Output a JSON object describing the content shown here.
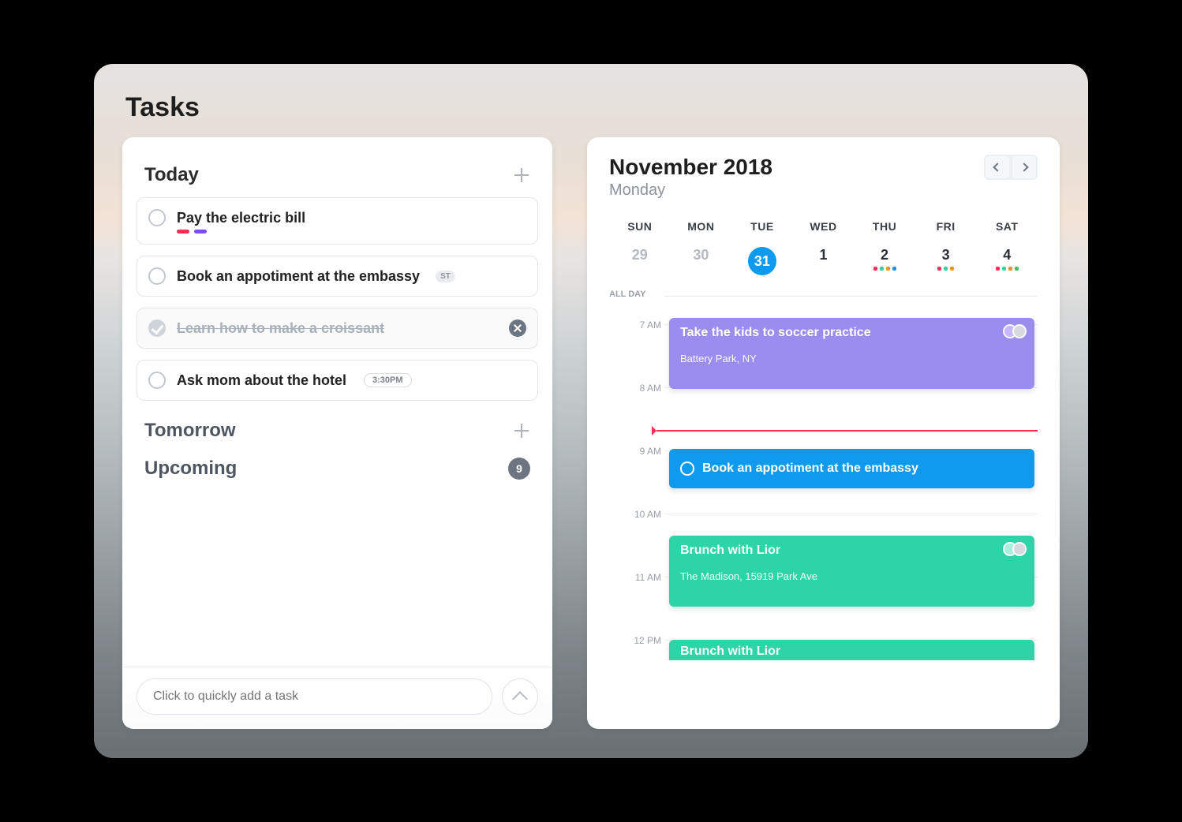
{
  "page": {
    "title": "Tasks"
  },
  "colors": {
    "pink": "#ff2d55",
    "purple": "#7c4dff",
    "blue": "#0f9af0",
    "teal": "#2dd4a7",
    "lilac": "#9b8cf0",
    "orange": "#ff9500",
    "green": "#34c759"
  },
  "tasks": {
    "sections": {
      "today": {
        "title": "Today"
      },
      "tomorrow": {
        "title": "Tomorrow"
      },
      "upcoming": {
        "title": "Upcoming",
        "count": "9"
      }
    },
    "today_items": [
      {
        "title": "Pay the electric bill",
        "tags": [
          "pink",
          "purple"
        ]
      },
      {
        "title": "Book an appotiment at the embassy",
        "badge": "ST"
      },
      {
        "title": "Learn how to make a croissant",
        "completed": true
      },
      {
        "title": "Ask mom about the hotel",
        "time": "3:30PM"
      }
    ],
    "add_placeholder": "Click to quickly add a task"
  },
  "calendar": {
    "month": "November 2018",
    "dayname": "Monday",
    "weekdays": [
      "SUN",
      "MON",
      "TUE",
      "WED",
      "THU",
      "FRI",
      "SAT"
    ],
    "dates": [
      {
        "n": "29",
        "dim": true
      },
      {
        "n": "30",
        "dim": true
      },
      {
        "n": "31",
        "selected": true
      },
      {
        "n": "1"
      },
      {
        "n": "2",
        "dots": [
          "pink",
          "teal",
          "orange",
          "blue"
        ]
      },
      {
        "n": "3",
        "dots": [
          "pink",
          "teal",
          "orange"
        ]
      },
      {
        "n": "4",
        "dots": [
          "pink",
          "teal",
          "orange",
          "green"
        ]
      }
    ],
    "allday_label": "ALL DAY",
    "hours": [
      "7 AM",
      "8 AM",
      "9 AM",
      "10 AM",
      "11 AM",
      "12 PM"
    ],
    "events": [
      {
        "title": "Take the kids to soccer practice",
        "sub": "Battery Park, NY",
        "color": "lilac",
        "avatars": 2
      },
      {
        "title": "Book an appotiment at the embassy",
        "color": "blue",
        "circle": true
      },
      {
        "title": "Brunch with Lior",
        "sub": "The Madison, 15919 Park Ave",
        "color": "teal",
        "avatars": 2
      },
      {
        "title": "Brunch with Lior",
        "color": "teal"
      }
    ]
  }
}
